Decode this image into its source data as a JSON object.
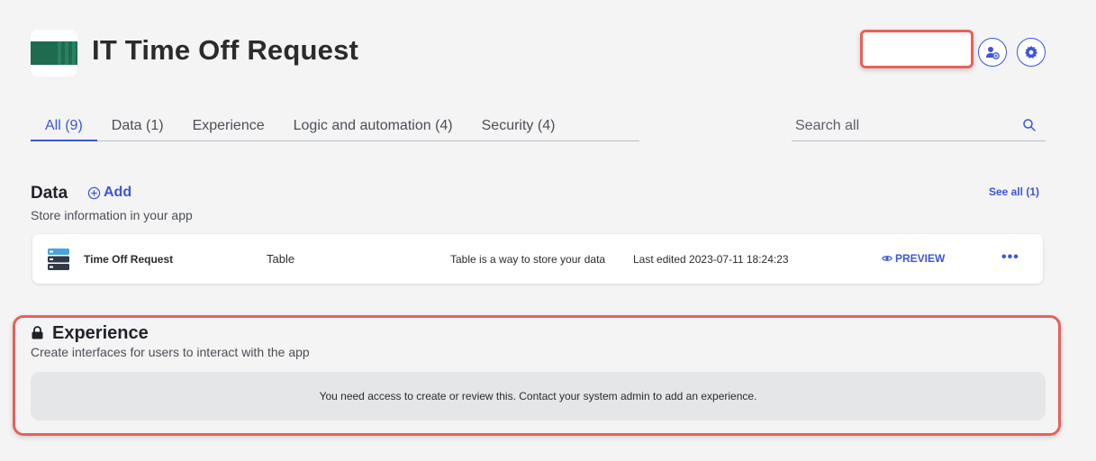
{
  "app": {
    "title": "IT Time Off Request"
  },
  "header": {
    "members_icon": "user-add-icon",
    "settings_icon": "gear-icon"
  },
  "tabs": [
    {
      "label": "All (9)",
      "active": true
    },
    {
      "label": "Data (1)",
      "active": false
    },
    {
      "label": "Experience",
      "active": false
    },
    {
      "label": "Logic and automation (4)",
      "active": false
    },
    {
      "label": "Security (4)",
      "active": false
    }
  ],
  "search": {
    "placeholder": "Search all"
  },
  "data_section": {
    "title": "Data",
    "add_label": "Add",
    "see_all_label": "See all (1)",
    "subtitle": "Store information in your app",
    "items": [
      {
        "name": "Time Off Request",
        "type": "Table",
        "description": "Table is a way to store your data",
        "last_edited": "Last edited 2023-07-11 18:24:23",
        "preview_label": "PREVIEW",
        "more_label": "•••"
      }
    ]
  },
  "experience_section": {
    "title": "Experience",
    "subtitle": "Create interfaces for users to interact with the app",
    "notice": "You need access to create or review this. Contact your system admin to add an experience."
  },
  "colors": {
    "accent": "#3b55d9",
    "highlight": "#e8615a",
    "background": "#f4f4f5",
    "logo": "#1e6b4f"
  }
}
